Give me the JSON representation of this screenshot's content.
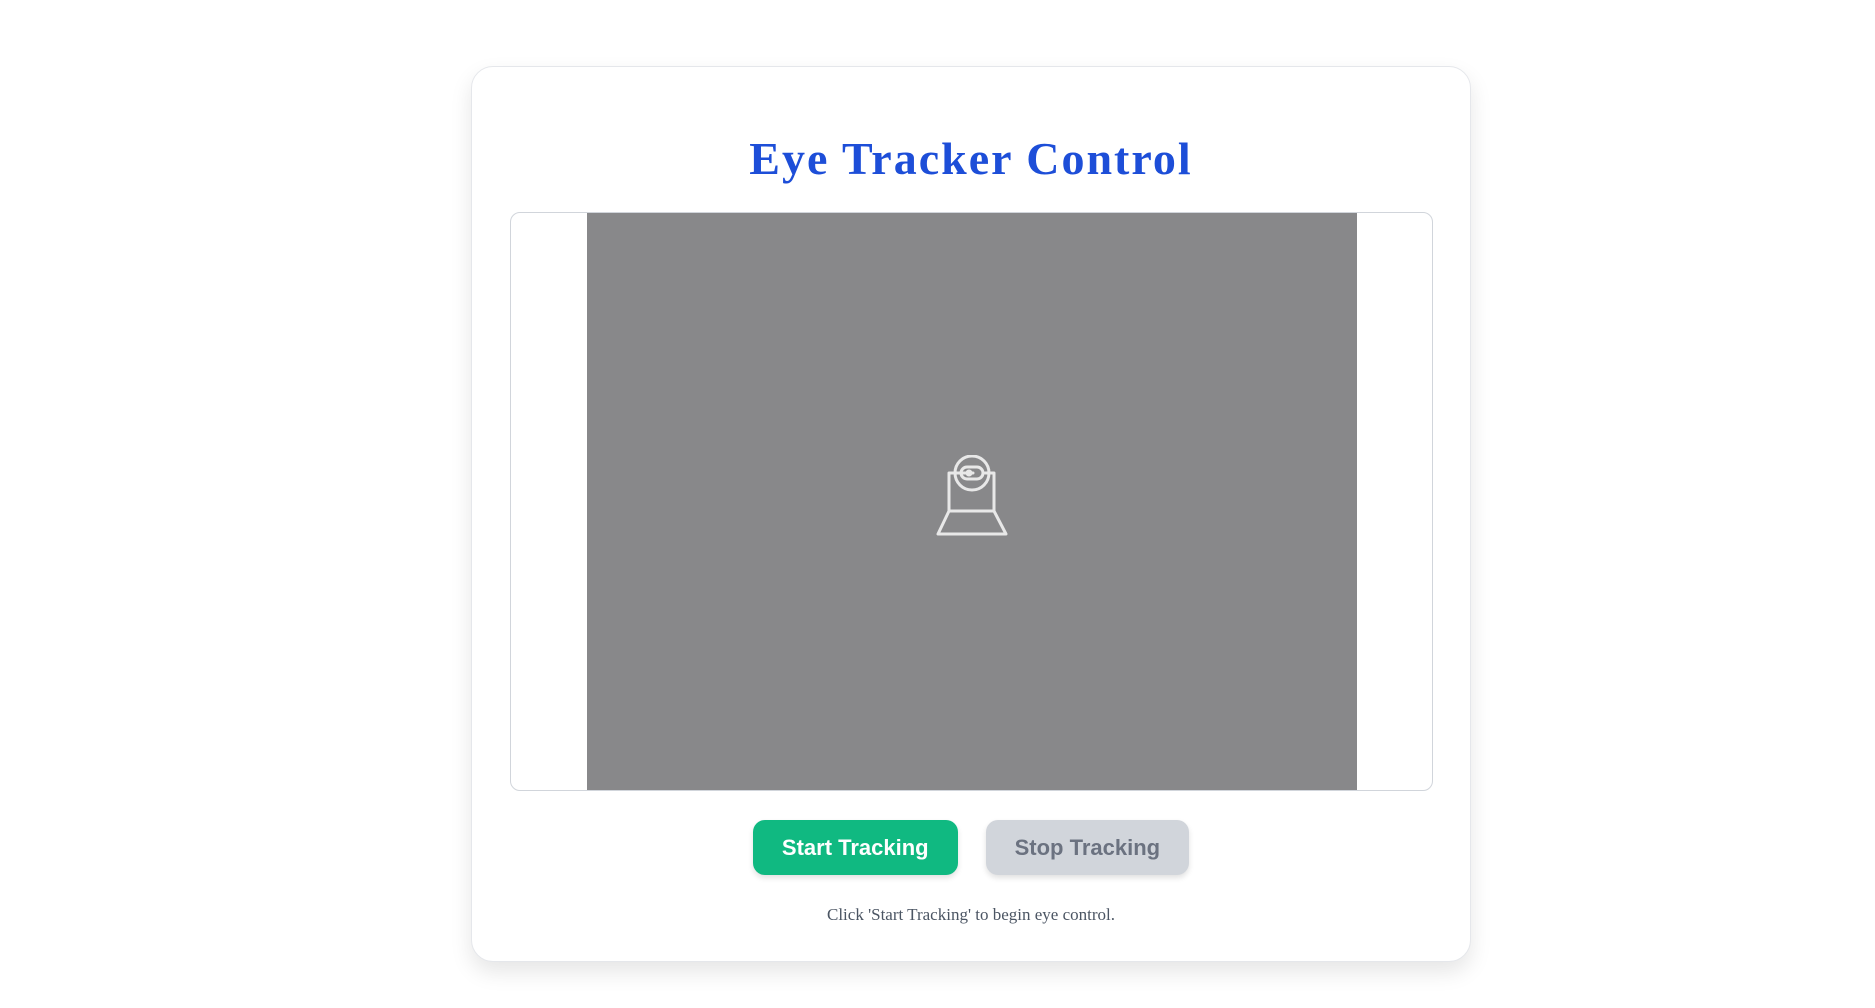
{
  "app": {
    "title": "Eye Tracker Control"
  },
  "video": {
    "icon": "webcam-icon",
    "background_color": "#88888a"
  },
  "controls": {
    "start_label": "Start Tracking",
    "stop_label": "Stop Tracking",
    "start_color": "#10b981",
    "stop_color": "#d1d5db"
  },
  "status": {
    "message": "Click 'Start Tracking' to begin eye control."
  },
  "colors": {
    "title": "#1d4ed8"
  }
}
